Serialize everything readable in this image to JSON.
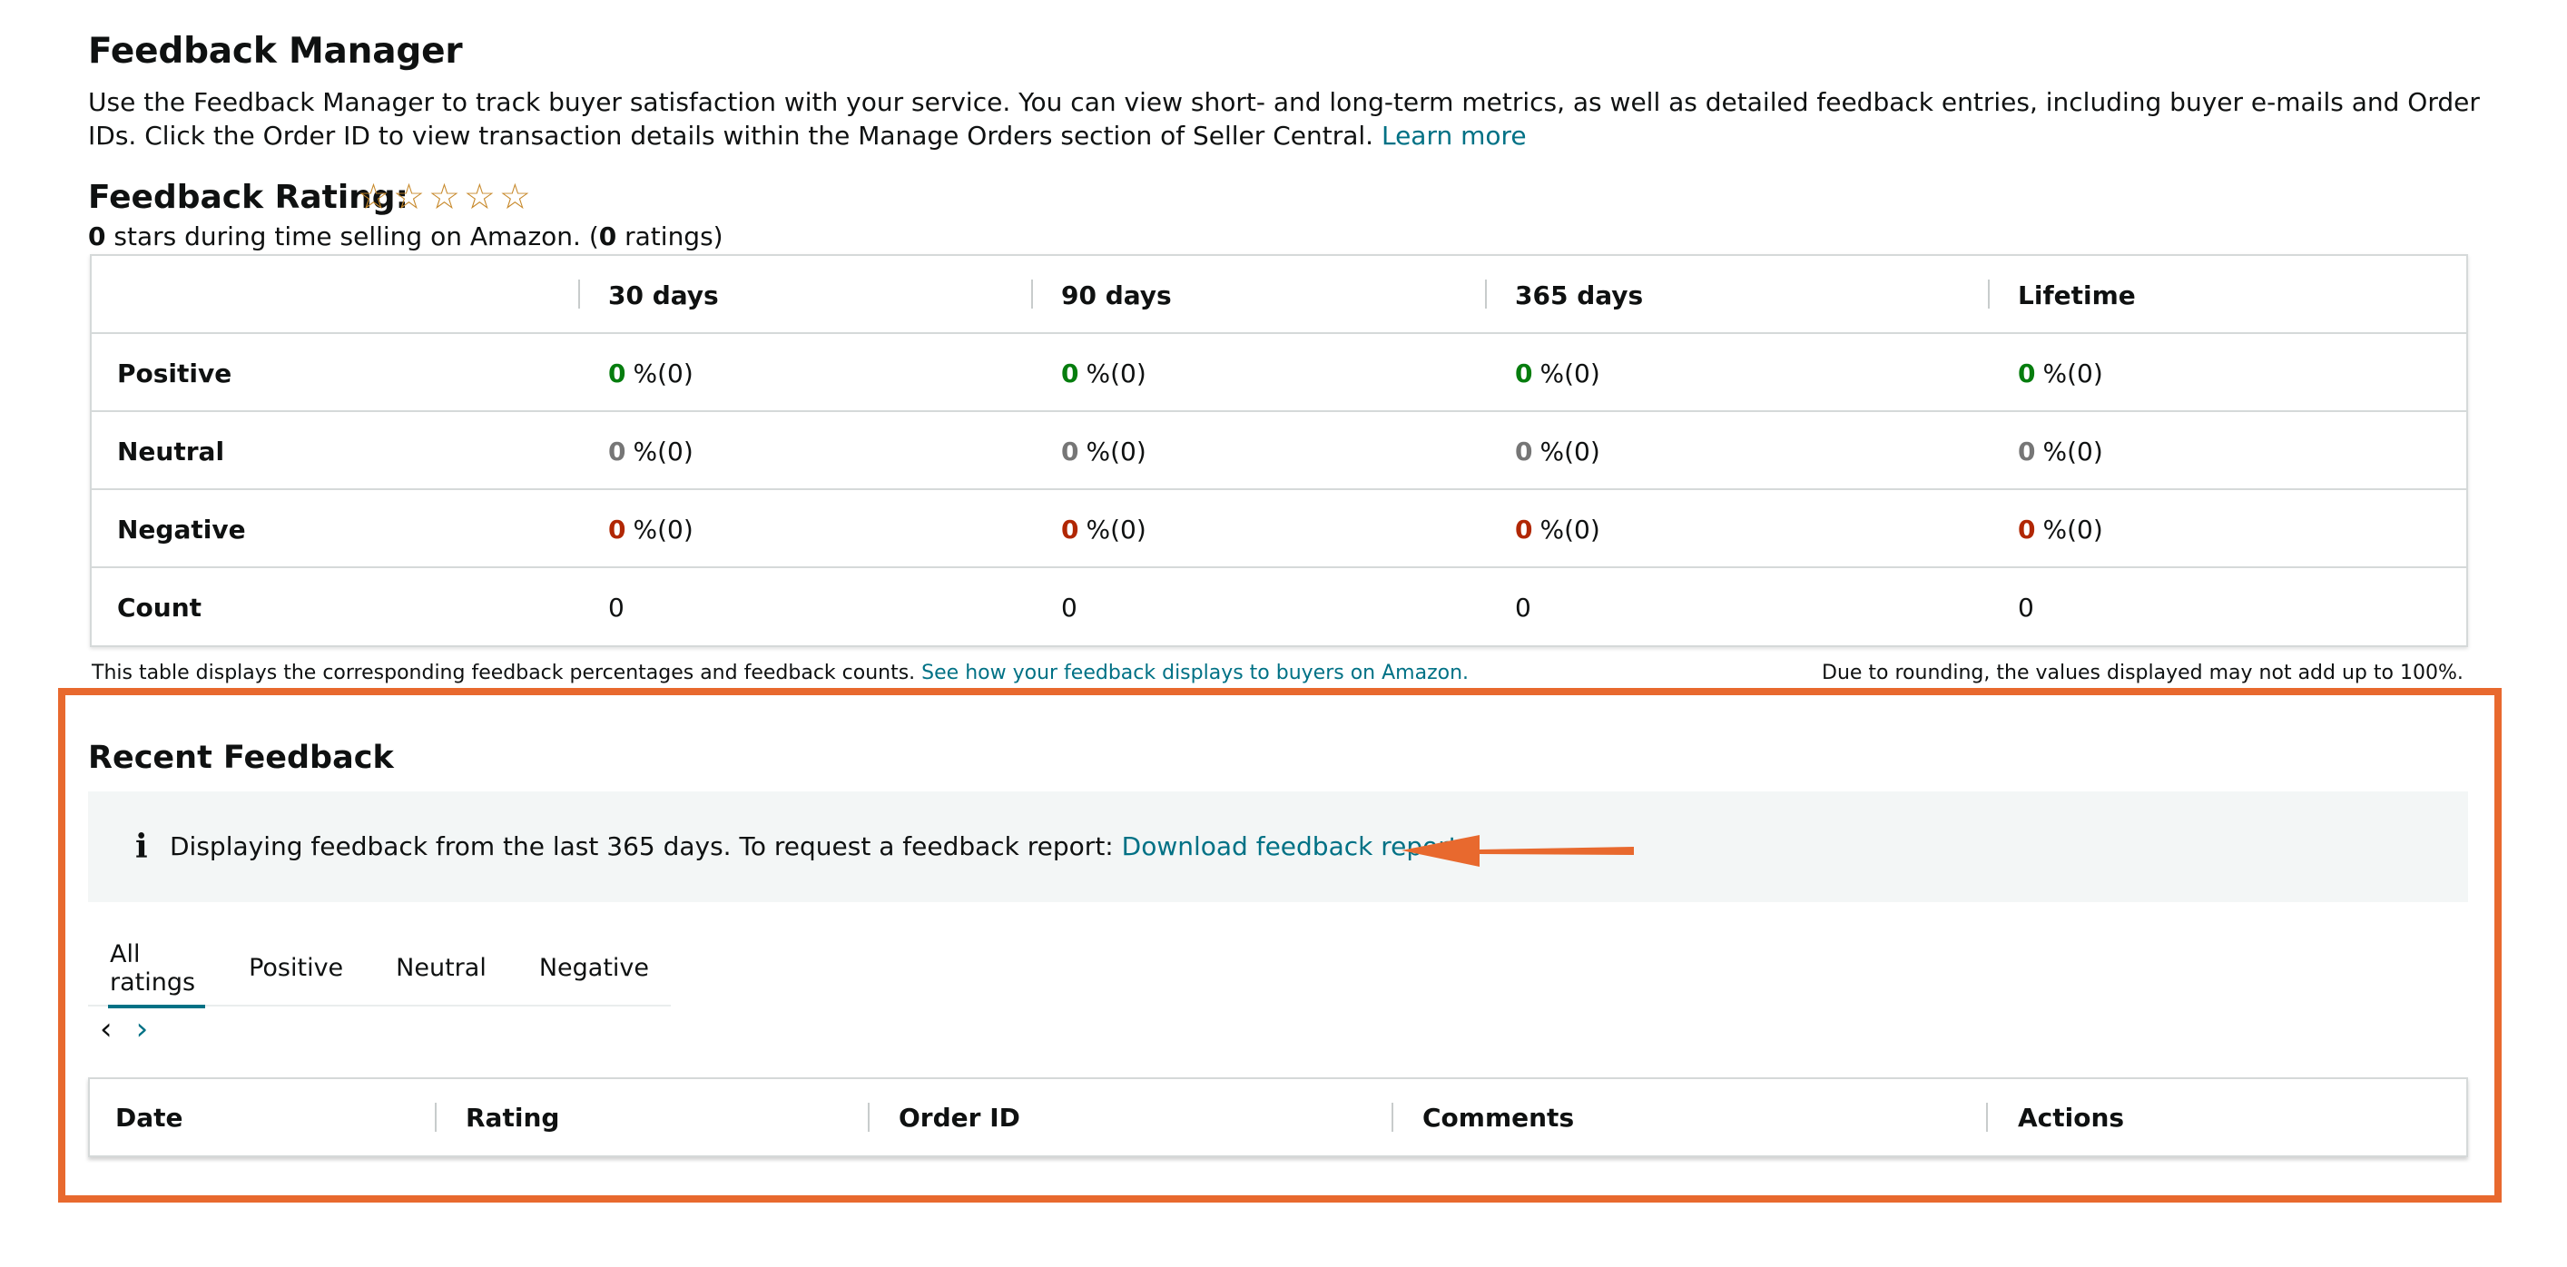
{
  "header": {
    "title": "Feedback Manager",
    "description": "Use the Feedback Manager to track buyer satisfaction with your service. You can view short- and long-term metrics, as well as detailed feedback entries, including buyer e-mails and Order IDs. Click the Order ID to view transaction details within the Manage Orders section of Seller Central.",
    "learn_more": "Learn more"
  },
  "rating": {
    "label": "Feedback Rating:",
    "stars_filled": 0,
    "stars_total": 5,
    "stars_value": "0",
    "stars_text": " stars during time selling on Amazon. (",
    "ratings_count": "0",
    "ratings_text": " ratings)"
  },
  "metrics_table": {
    "columns": [
      "30 days",
      "90 days",
      "365 days",
      "Lifetime"
    ],
    "rows": [
      {
        "label": "Positive",
        "values": [
          {
            "n": "0",
            "p": "%(0)"
          },
          {
            "n": "0",
            "p": "%(0)"
          },
          {
            "n": "0",
            "p": "%(0)"
          },
          {
            "n": "0",
            "p": "%(0)"
          }
        ]
      },
      {
        "label": "Neutral",
        "values": [
          {
            "n": "0",
            "p": "%(0)"
          },
          {
            "n": "0",
            "p": "%(0)"
          },
          {
            "n": "0",
            "p": "%(0)"
          },
          {
            "n": "0",
            "p": "%(0)"
          }
        ]
      },
      {
        "label": "Negative",
        "values": [
          {
            "n": "0",
            "p": "%(0)"
          },
          {
            "n": "0",
            "p": "%(0)"
          },
          {
            "n": "0",
            "p": "%(0)"
          },
          {
            "n": "0",
            "p": "%(0)"
          }
        ]
      },
      {
        "label": "Count",
        "values": [
          "0",
          "0",
          "0",
          "0"
        ]
      }
    ]
  },
  "notes": {
    "left_text": "This table displays the corresponding feedback percentages and feedback counts. ",
    "left_link": "See how your feedback displays to buyers on Amazon.",
    "right_text": "Due to rounding, the values displayed may not add up to 100%."
  },
  "recent": {
    "title": "Recent Feedback",
    "info_icon": "i",
    "info_text": "Displaying feedback from the last 365 days. To request a feedback report: ",
    "info_link": "Download feedback report",
    "tabs": [
      "All ratings",
      "Positive",
      "Neutral",
      "Negative"
    ],
    "active_tab": 0,
    "pager_prev": "‹",
    "pager_next": "›",
    "table_columns": [
      "Date",
      "Rating",
      "Order ID",
      "Comments",
      "Actions"
    ]
  },
  "colors": {
    "highlight": "#e8692e",
    "link": "#007185",
    "positive": "#067d0e",
    "negative": "#b12704",
    "neutral": "#767676",
    "star": "#c7892b"
  },
  "icons": {
    "rating_star": "star-outline-icon",
    "info": "info-icon",
    "annotation_arrow": "arrow-left-icon"
  }
}
